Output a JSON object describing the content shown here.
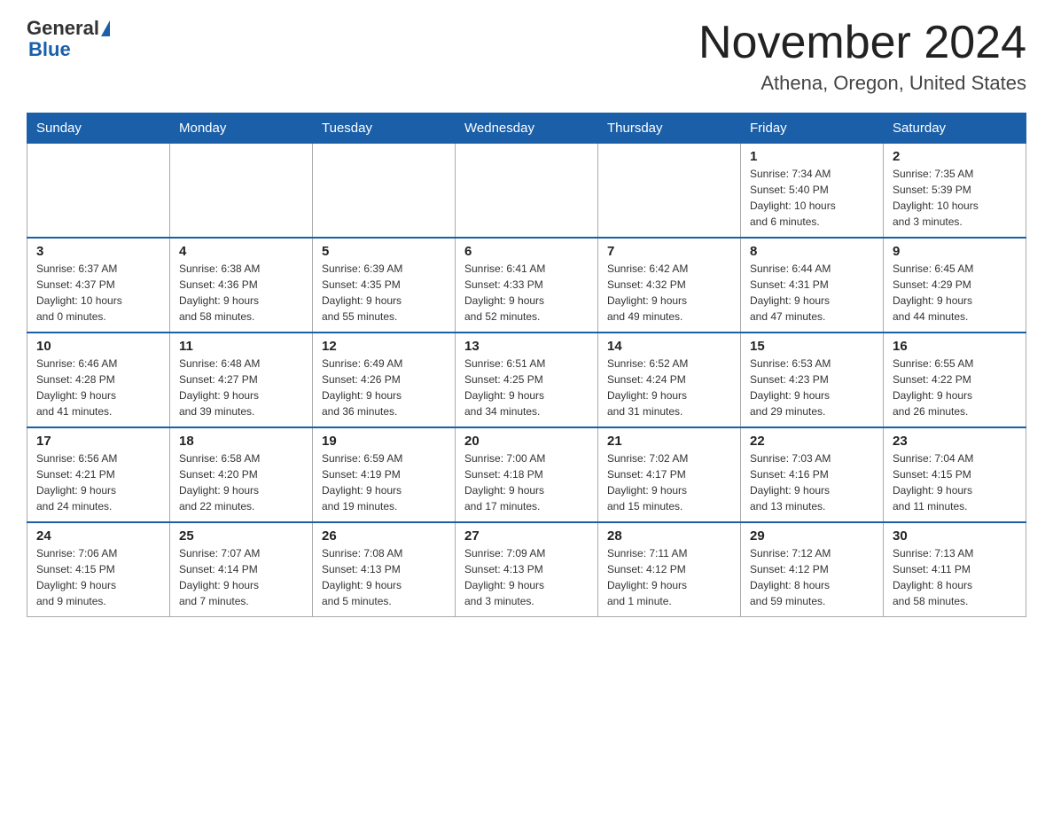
{
  "header": {
    "logo_general": "General",
    "logo_blue": "Blue",
    "month_title": "November 2024",
    "location": "Athena, Oregon, United States"
  },
  "days_of_week": [
    "Sunday",
    "Monday",
    "Tuesday",
    "Wednesday",
    "Thursday",
    "Friday",
    "Saturday"
  ],
  "weeks": [
    [
      {
        "day": "",
        "info": ""
      },
      {
        "day": "",
        "info": ""
      },
      {
        "day": "",
        "info": ""
      },
      {
        "day": "",
        "info": ""
      },
      {
        "day": "",
        "info": ""
      },
      {
        "day": "1",
        "info": "Sunrise: 7:34 AM\nSunset: 5:40 PM\nDaylight: 10 hours\nand 6 minutes."
      },
      {
        "day": "2",
        "info": "Sunrise: 7:35 AM\nSunset: 5:39 PM\nDaylight: 10 hours\nand 3 minutes."
      }
    ],
    [
      {
        "day": "3",
        "info": "Sunrise: 6:37 AM\nSunset: 4:37 PM\nDaylight: 10 hours\nand 0 minutes."
      },
      {
        "day": "4",
        "info": "Sunrise: 6:38 AM\nSunset: 4:36 PM\nDaylight: 9 hours\nand 58 minutes."
      },
      {
        "day": "5",
        "info": "Sunrise: 6:39 AM\nSunset: 4:35 PM\nDaylight: 9 hours\nand 55 minutes."
      },
      {
        "day": "6",
        "info": "Sunrise: 6:41 AM\nSunset: 4:33 PM\nDaylight: 9 hours\nand 52 minutes."
      },
      {
        "day": "7",
        "info": "Sunrise: 6:42 AM\nSunset: 4:32 PM\nDaylight: 9 hours\nand 49 minutes."
      },
      {
        "day": "8",
        "info": "Sunrise: 6:44 AM\nSunset: 4:31 PM\nDaylight: 9 hours\nand 47 minutes."
      },
      {
        "day": "9",
        "info": "Sunrise: 6:45 AM\nSunset: 4:29 PM\nDaylight: 9 hours\nand 44 minutes."
      }
    ],
    [
      {
        "day": "10",
        "info": "Sunrise: 6:46 AM\nSunset: 4:28 PM\nDaylight: 9 hours\nand 41 minutes."
      },
      {
        "day": "11",
        "info": "Sunrise: 6:48 AM\nSunset: 4:27 PM\nDaylight: 9 hours\nand 39 minutes."
      },
      {
        "day": "12",
        "info": "Sunrise: 6:49 AM\nSunset: 4:26 PM\nDaylight: 9 hours\nand 36 minutes."
      },
      {
        "day": "13",
        "info": "Sunrise: 6:51 AM\nSunset: 4:25 PM\nDaylight: 9 hours\nand 34 minutes."
      },
      {
        "day": "14",
        "info": "Sunrise: 6:52 AM\nSunset: 4:24 PM\nDaylight: 9 hours\nand 31 minutes."
      },
      {
        "day": "15",
        "info": "Sunrise: 6:53 AM\nSunset: 4:23 PM\nDaylight: 9 hours\nand 29 minutes."
      },
      {
        "day": "16",
        "info": "Sunrise: 6:55 AM\nSunset: 4:22 PM\nDaylight: 9 hours\nand 26 minutes."
      }
    ],
    [
      {
        "day": "17",
        "info": "Sunrise: 6:56 AM\nSunset: 4:21 PM\nDaylight: 9 hours\nand 24 minutes."
      },
      {
        "day": "18",
        "info": "Sunrise: 6:58 AM\nSunset: 4:20 PM\nDaylight: 9 hours\nand 22 minutes."
      },
      {
        "day": "19",
        "info": "Sunrise: 6:59 AM\nSunset: 4:19 PM\nDaylight: 9 hours\nand 19 minutes."
      },
      {
        "day": "20",
        "info": "Sunrise: 7:00 AM\nSunset: 4:18 PM\nDaylight: 9 hours\nand 17 minutes."
      },
      {
        "day": "21",
        "info": "Sunrise: 7:02 AM\nSunset: 4:17 PM\nDaylight: 9 hours\nand 15 minutes."
      },
      {
        "day": "22",
        "info": "Sunrise: 7:03 AM\nSunset: 4:16 PM\nDaylight: 9 hours\nand 13 minutes."
      },
      {
        "day": "23",
        "info": "Sunrise: 7:04 AM\nSunset: 4:15 PM\nDaylight: 9 hours\nand 11 minutes."
      }
    ],
    [
      {
        "day": "24",
        "info": "Sunrise: 7:06 AM\nSunset: 4:15 PM\nDaylight: 9 hours\nand 9 minutes."
      },
      {
        "day": "25",
        "info": "Sunrise: 7:07 AM\nSunset: 4:14 PM\nDaylight: 9 hours\nand 7 minutes."
      },
      {
        "day": "26",
        "info": "Sunrise: 7:08 AM\nSunset: 4:13 PM\nDaylight: 9 hours\nand 5 minutes."
      },
      {
        "day": "27",
        "info": "Sunrise: 7:09 AM\nSunset: 4:13 PM\nDaylight: 9 hours\nand 3 minutes."
      },
      {
        "day": "28",
        "info": "Sunrise: 7:11 AM\nSunset: 4:12 PM\nDaylight: 9 hours\nand 1 minute."
      },
      {
        "day": "29",
        "info": "Sunrise: 7:12 AM\nSunset: 4:12 PM\nDaylight: 8 hours\nand 59 minutes."
      },
      {
        "day": "30",
        "info": "Sunrise: 7:13 AM\nSunset: 4:11 PM\nDaylight: 8 hours\nand 58 minutes."
      }
    ]
  ]
}
